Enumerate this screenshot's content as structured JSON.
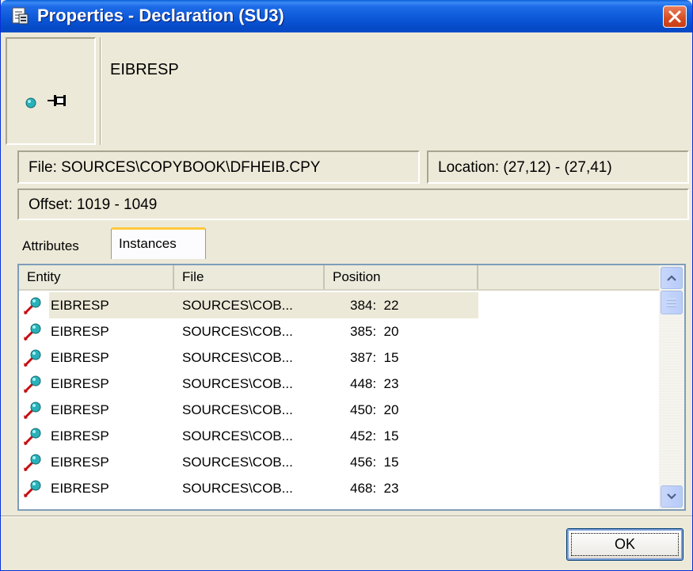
{
  "window": {
    "title": "Properties - Declaration (SU3)",
    "accent": "#0a56d6"
  },
  "header": {
    "name": "EIBRESP",
    "file": "File: SOURCES\\COPYBOOK\\DFHEIB.CPY",
    "location": "Location: (27,12) - (27,41)",
    "offset": "Offset: 1019 - 1049"
  },
  "tabs": [
    {
      "label": "Attributes",
      "active": false
    },
    {
      "label": "Instances",
      "active": true
    }
  ],
  "table": {
    "columns": [
      "Entity",
      "File",
      "Position"
    ],
    "rows": [
      {
        "entity": "EIBRESP",
        "file": "SOURCES\\COB...",
        "position": "384:  22",
        "selected": true
      },
      {
        "entity": "EIBRESP",
        "file": "SOURCES\\COB...",
        "position": "385:  20"
      },
      {
        "entity": "EIBRESP",
        "file": "SOURCES\\COB...",
        "position": "387:  15"
      },
      {
        "entity": "EIBRESP",
        "file": "SOURCES\\COB...",
        "position": "448:  23"
      },
      {
        "entity": "EIBRESP",
        "file": "SOURCES\\COB...",
        "position": "450:  20"
      },
      {
        "entity": "EIBRESP",
        "file": "SOURCES\\COB...",
        "position": "452:  15"
      },
      {
        "entity": "EIBRESP",
        "file": "SOURCES\\COB...",
        "position": "456:  15"
      },
      {
        "entity": "EIBRESP",
        "file": "SOURCES\\COB...",
        "position": "468:  23"
      }
    ]
  },
  "footer": {
    "ok_label": "OK"
  },
  "icons": {
    "title": "properties-icon",
    "close": "close-icon",
    "state": "teal-dot-icon",
    "pin": "pin-icon",
    "row": "entity-reference-icon"
  }
}
